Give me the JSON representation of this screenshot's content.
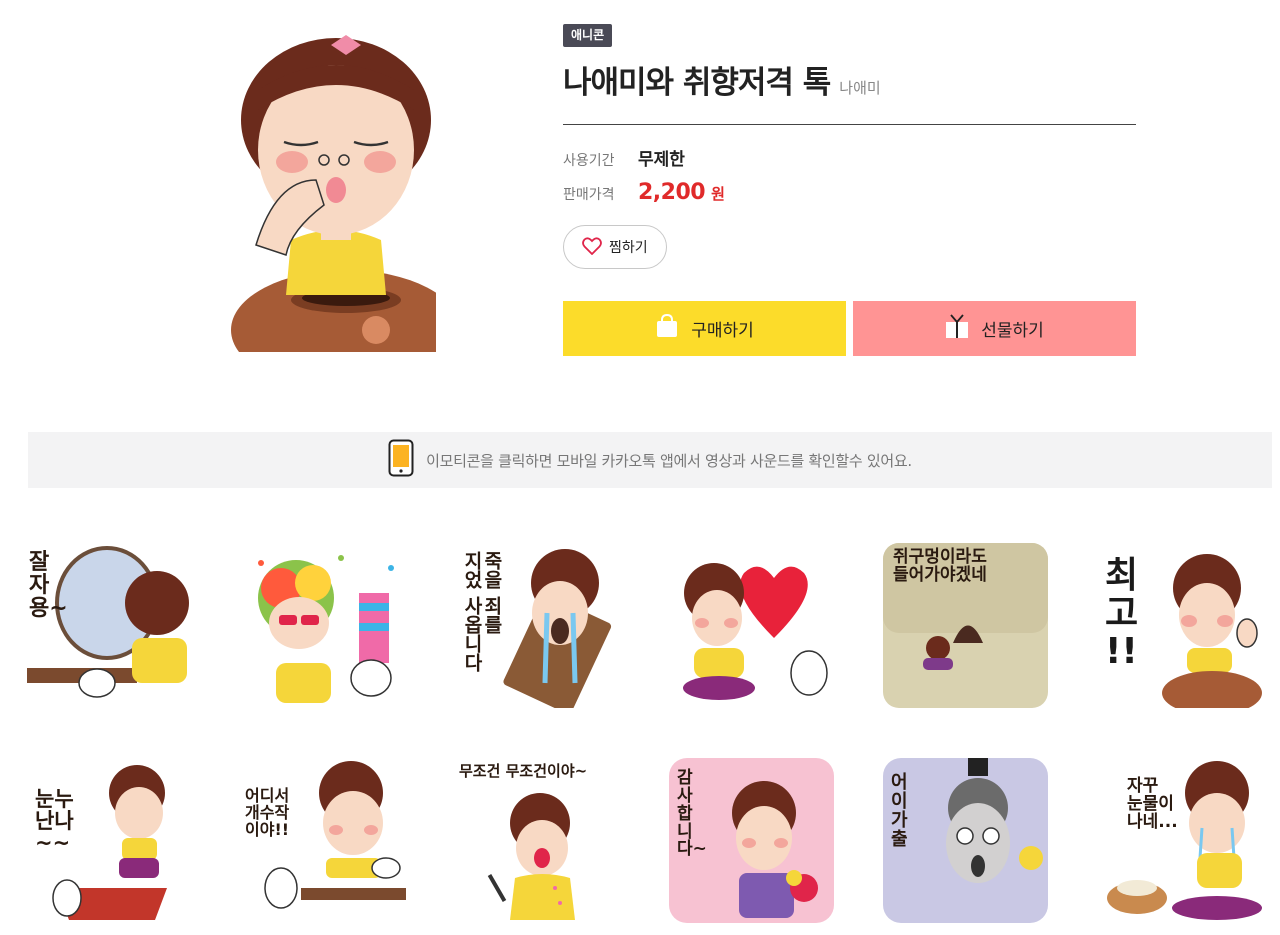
{
  "product": {
    "badge": "애니콘",
    "title": "나애미와 취향저격 톡",
    "author": "나애미",
    "period_label": "사용기간",
    "period_value": "무제한",
    "price_label": "판매가격",
    "price_value": "2,200",
    "price_unit": "원",
    "wish_label": "찜하기"
  },
  "actions": {
    "buy_label": "구매하기",
    "gift_label": "선물하기"
  },
  "notice": {
    "text": "이모티콘을 클릭하면 모바일 카카오톡 앱에서 영상과 사운드를 확인할수 있어요."
  },
  "stickers": [
    {
      "caption": "잘\n자\n용~"
    },
    {
      "caption": ""
    },
    {
      "caption": "죽을 죄를\n지었 사옵니다"
    },
    {
      "caption": ""
    },
    {
      "caption": "쥐구멍이라도\n들어가야겠네"
    },
    {
      "caption": "최\n고\n!!"
    },
    {
      "caption": "눈누\n난나\n~~"
    },
    {
      "caption": "어디서\n개수작\n이야!!"
    },
    {
      "caption": "무조건 무조건이야~"
    },
    {
      "caption": "감\n사\n합\n니\n다~"
    },
    {
      "caption": "어\n이\n가\n출"
    },
    {
      "caption": "자꾸\n눈물이\n나네..."
    }
  ],
  "colors": {
    "buy": "#fcdc2a",
    "gift": "#ff9494",
    "price": "#e02a2a",
    "hair": "#6b2b1c",
    "skin": "#f8d9c4"
  }
}
